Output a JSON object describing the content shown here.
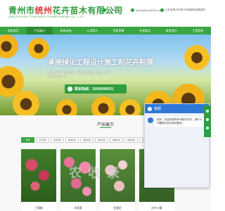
{
  "header": {
    "title_part1": "青州市",
    "title_highlight": "统州",
    "title_part2": "花卉苗木有限公司",
    "subtitle": "QINGZHOUSHI TONGZHOU FLOWER MAOMO CO., LTD",
    "phone": "15006666031",
    "email": "qzltongzhou@163.com",
    "address": "山东省青州市青州市黄楼街道青楼村"
  },
  "nav": {
    "items": [
      "网站首页",
      "产品展示",
      "新闻动态",
      "公司简介",
      "资质荣誉",
      "在线留言",
      "联系我们",
      "工程案例"
    ]
  },
  "banner": {
    "title": "承接绿化工程设计施工和花卉租摆",
    "desc_line1": "基本种苗花、宿根花卉、绿化苗木种植、销售，以及",
    "desc_line2": "绿化工程等一条",
    "hotline_label": "联系热线：15006666031"
  },
  "products": {
    "section_title": "产品展示",
    "categories": [
      "月季",
      "大花月季",
      "丰花月季",
      "藤本月季",
      "微型月季",
      "树状月季",
      "地被月季",
      "古桩月季",
      "造型月季",
      "盆栽月季"
    ],
    "items": [
      {
        "name": "三角梅"
      },
      {
        "name": "木芙蓉"
      },
      {
        "name": "金盏花"
      },
      {
        "name": "红叶小檗"
      }
    ]
  },
  "watermark": "农 收 录",
  "chat": {
    "title": "客服",
    "close": "×",
    "message": "您好，欢迎来到青州市统州花卉，请什么问题我们会尽快回复您。"
  },
  "colors": {
    "brand_green": "#3aa543",
    "accent_red": "#e23b3b",
    "chat_blue": "#2f78d8"
  }
}
